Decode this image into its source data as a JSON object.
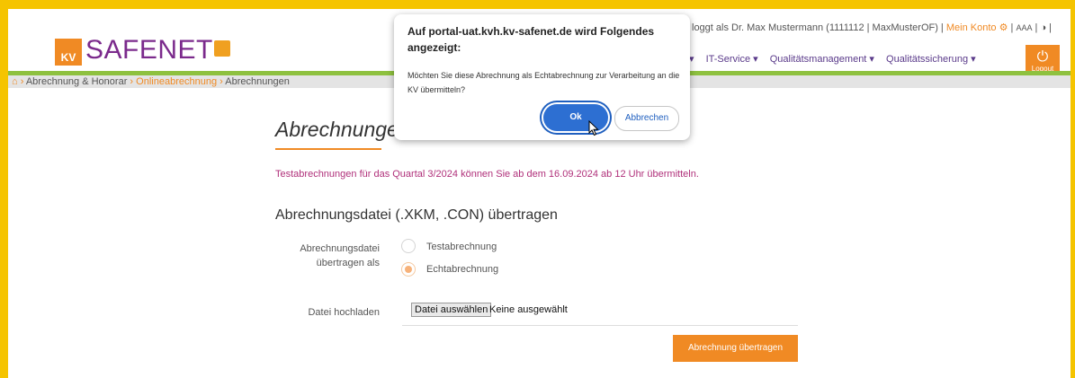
{
  "header": {
    "logo_prefix": "KV",
    "logo_text": "SAFENET",
    "user_prefix": "loggt als Dr. Max Mustermann (1111112 | MaxMusterOF) |",
    "account_label": "Mein Konto",
    "settings_symbol": "⚙",
    "font_size_label": "AAA",
    "contrast_symbol": "◑",
    "nav_items": [
      "▾",
      "IT-Service ▾",
      "Qualitätsmanagement ▾",
      "Qualitätssicherung ▾"
    ],
    "logout_label": "Logout"
  },
  "breadcrumb": {
    "home_icon": "home-icon",
    "item1": "Abrechnung & Honorar",
    "item2": "Onlineabrechnung",
    "item3": "Abrechnungen",
    "sep": "›"
  },
  "main": {
    "title": "Abrechnungen",
    "notice": "Testabrechnungen für das Quartal 3/2024 können Sie ab dem 16.09.2024 ab 12 Uhr übermitteln.",
    "section_title": "Abrechnungsdatei (.XKM, .CON) übertragen",
    "transfer_label": "Abrechnungsdatei übertragen als",
    "option_test": "Testabrechnung",
    "option_real": "Echtabrechnung",
    "selected_option": "Echtabrechnung",
    "upload_label": "Datei hochladen",
    "file_button": "Datei auswählen",
    "file_status": "Keine ausgewählt",
    "submit_label": "Abrechnung übertragen"
  },
  "dialog": {
    "title": "Auf portal-uat.kvh.kv-safenet.de wird Folgendes angezeigt:",
    "message": "Möchten Sie diese Abrechnung als Echtabrechnung zur Verarbeitung an die KV übermitteln?",
    "ok_label": "Ok",
    "cancel_label": "Abbrechen"
  },
  "colors": {
    "accent": "#f08a24",
    "brand_purple": "#7b2a8c",
    "nav_green": "#8ec13f",
    "notice": "#b0307a",
    "dialog_primary": "#2d6fd2",
    "frame": "#f5c400"
  }
}
